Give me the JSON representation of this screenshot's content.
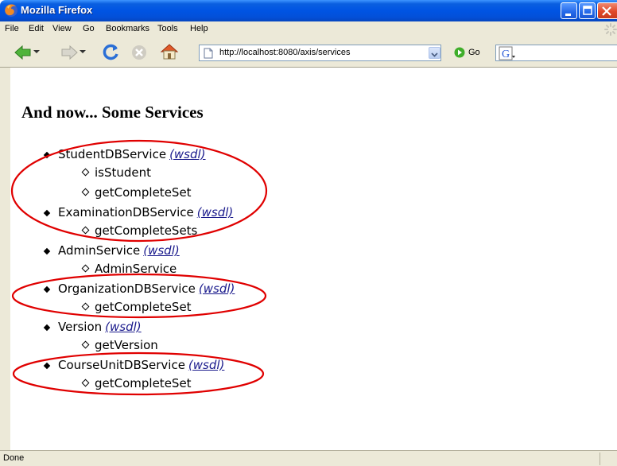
{
  "window": {
    "title": "Mozilla Firefox",
    "title_color": "#0054e3"
  },
  "menu": {
    "items": [
      {
        "label": "File"
      },
      {
        "label": "Edit"
      },
      {
        "label": "View"
      },
      {
        "label": "Go"
      },
      {
        "label": "Bookmarks"
      },
      {
        "label": "Tools"
      },
      {
        "label": "Help"
      }
    ]
  },
  "toolbar": {
    "back_icon": "back-arrow-icon",
    "forward_icon": "forward-arrow-icon",
    "reload_icon": "reload-icon",
    "stop_icon": "stop-icon",
    "home_icon": "home-icon",
    "url": "http://localhost:8080/axis/services",
    "go_label": "Go",
    "search_engine_icon": "google-icon"
  },
  "page": {
    "heading": "And now... Some Services",
    "wsdl_link_label": "(wsdl)",
    "link_color": "#1a1a8c",
    "annotation_color": "#e00000",
    "services": [
      {
        "name": "StudentDBService",
        "operations": [
          "isStudent",
          "getCompleteSet"
        ]
      },
      {
        "name": "ExaminationDBService",
        "operations": [
          "getCompleteSets"
        ]
      },
      {
        "name": "AdminService",
        "operations": [
          "AdminService"
        ]
      },
      {
        "name": "OrganizationDBService",
        "operations": [
          "getCompleteSet"
        ]
      },
      {
        "name": "Version",
        "operations": [
          "getVersion"
        ]
      },
      {
        "name": "CourseUnitDBService",
        "operations": [
          "getCompleteSet"
        ]
      }
    ]
  },
  "status": {
    "text": "Done"
  }
}
